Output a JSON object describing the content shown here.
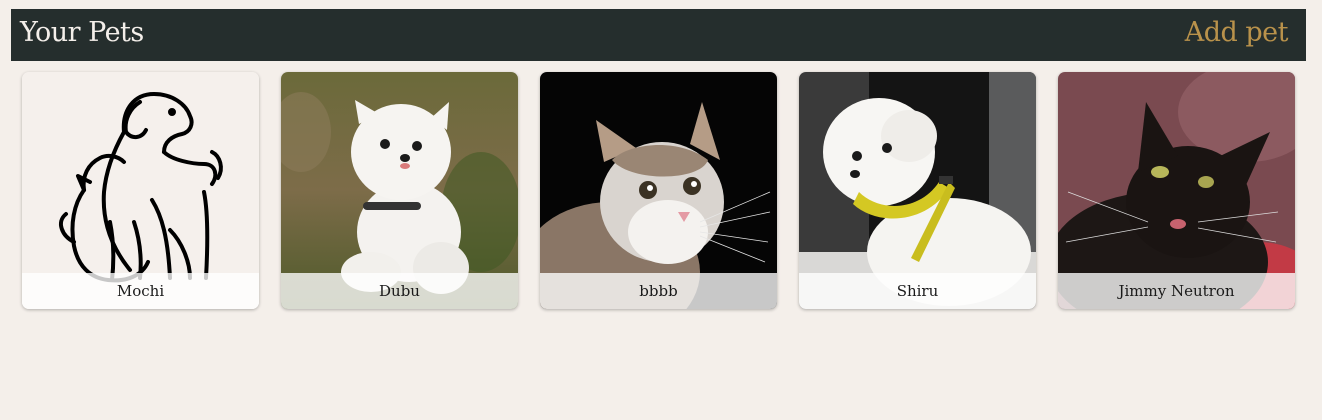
{
  "header": {
    "title": "Your Pets",
    "add_label": "Add pet"
  },
  "pets": [
    {
      "name": "Mochi",
      "image": "dog-and-cat-outline-placeholder-icon"
    },
    {
      "name": "Dubu",
      "image": "white-pomeranian-photo"
    },
    {
      "name": "bbbb",
      "image": "tabby-white-cat-photo"
    },
    {
      "name": "Shiru",
      "image": "white-maltese-dog-photo"
    },
    {
      "name": "Jimmy Neutron",
      "image": "black-cat-photo"
    }
  ],
  "colors": {
    "background": "#f4efea",
    "header_bg": "#252e2d",
    "header_title": "#f4efea",
    "accent": "#b9924b"
  }
}
